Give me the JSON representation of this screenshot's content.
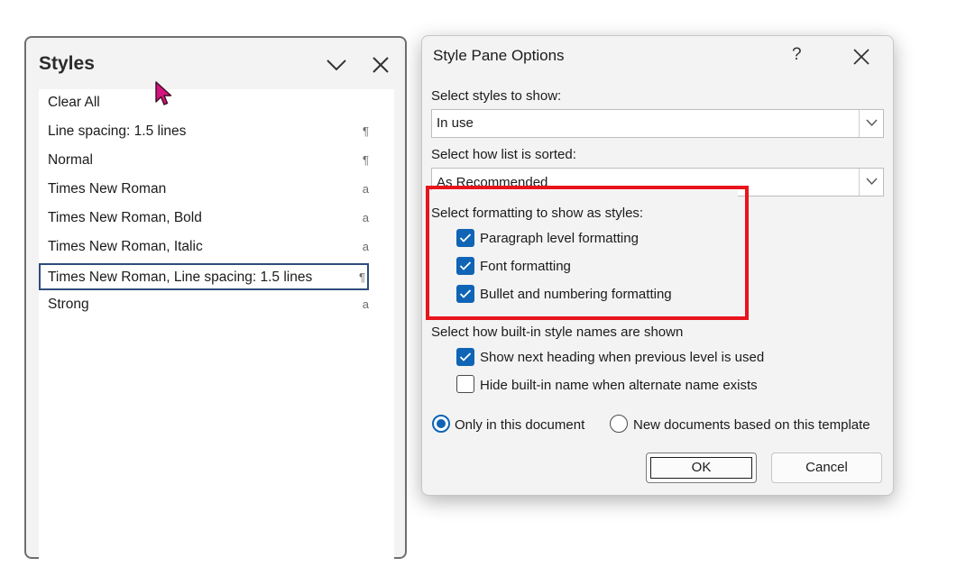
{
  "styles_pane": {
    "title": "Styles",
    "items": [
      {
        "label": "Clear All",
        "mark": ""
      },
      {
        "label": "Line spacing:  1.5 lines",
        "mark": "¶"
      },
      {
        "label": "Normal",
        "mark": "¶"
      },
      {
        "label": "Times New Roman",
        "mark": "a"
      },
      {
        "label": "Times New Roman, Bold",
        "mark": "a"
      },
      {
        "label": "Times New Roman, Italic",
        "mark": "a"
      },
      {
        "label": "Times New Roman, Line spacing:  1.5 lines",
        "mark": "¶"
      },
      {
        "label": "Strong",
        "mark": "a"
      }
    ],
    "selected_index": 6
  },
  "dialog": {
    "title": "Style Pane Options",
    "help": "?",
    "styles_to_show_label": "Select styles to show:",
    "styles_to_show_value": "In use",
    "sort_label": "Select how list is sorted:",
    "sort_value": "As Recommended",
    "formatting_label": "Select formatting to show as styles:",
    "formatting_options": [
      {
        "label": "Paragraph level formatting",
        "checked": true
      },
      {
        "label": "Font formatting",
        "checked": true
      },
      {
        "label": "Bullet and numbering formatting",
        "checked": true
      }
    ],
    "builtin_label": "Select how built-in style names are shown",
    "builtin_options": [
      {
        "label": "Show next heading when previous level is used",
        "checked": true
      },
      {
        "label": "Hide built-in name when alternate name exists",
        "checked": false
      }
    ],
    "scope_options": [
      {
        "label": "Only in this document",
        "selected": true
      },
      {
        "label": "New documents based on this template",
        "selected": false
      }
    ],
    "ok_label": "OK",
    "cancel_label": "Cancel"
  },
  "colors": {
    "accent": "#0f64b5",
    "highlight": "#e8141c",
    "cursor": "#d4157f"
  }
}
